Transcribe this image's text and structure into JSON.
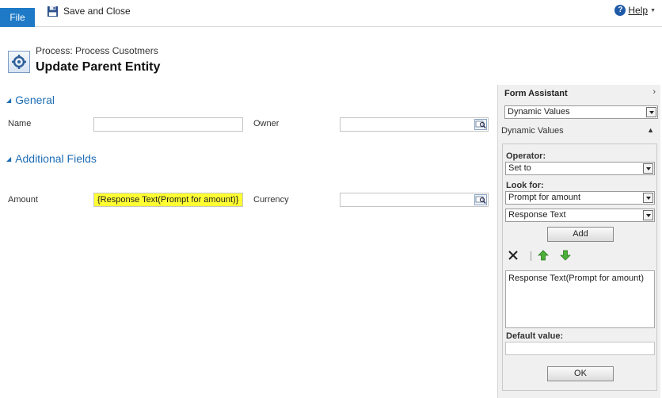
{
  "ribbon": {
    "file_tab": "File",
    "save_close_label": "Save and Close",
    "help_label": "Help"
  },
  "header": {
    "process_label": "Process: Process Cusotmers",
    "entity_title": "Update Parent Entity"
  },
  "sections": {
    "general": {
      "title": "General",
      "name_label": "Name",
      "name_value": "",
      "owner_label": "Owner",
      "owner_value": ""
    },
    "additional": {
      "title": "Additional Fields",
      "amount_label": "Amount",
      "amount_value": "{Response Text(Prompt for amount)}",
      "currency_label": "Currency",
      "currency_value": ""
    }
  },
  "form_assistant": {
    "title": "Form Assistant",
    "mode_select": "Dynamic Values",
    "subheading": "Dynamic Values",
    "operator_label": "Operator:",
    "operator_value": "Set to",
    "look_for_label": "Look for:",
    "look_for_entity": "Prompt for amount",
    "look_for_attribute": "Response Text",
    "add_button": "Add",
    "expression_text": "Response Text(Prompt for amount)",
    "default_value_label": "Default value:",
    "default_value": "",
    "ok_button": "OK"
  },
  "colors": {
    "accent": "#1e7ac6",
    "section_title": "#1e6db5",
    "highlight": "#ffff33",
    "panel_bg": "#f0f0f0"
  },
  "icons": [
    "save-icon",
    "help-icon",
    "process-icon",
    "lookup-icon",
    "delete-icon",
    "move-up-icon",
    "move-down-icon",
    "collapse-icon"
  ]
}
